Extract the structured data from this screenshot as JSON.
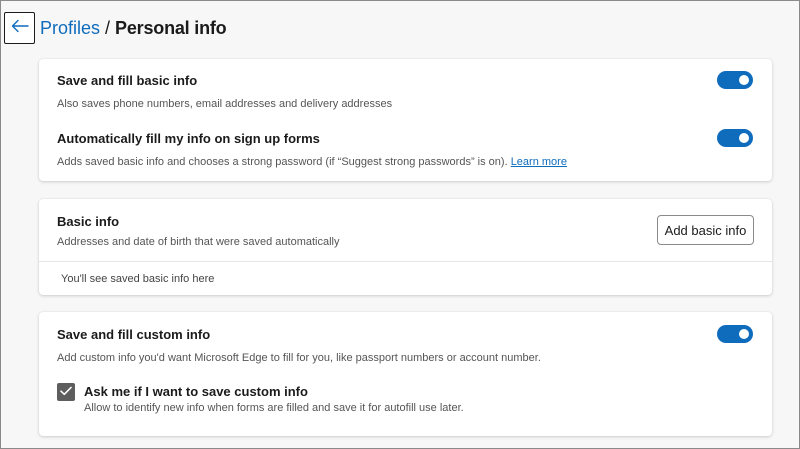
{
  "header": {
    "back_icon": "arrow-left-icon",
    "breadcrumb_parent": "Profiles",
    "breadcrumb_separator": "/",
    "breadcrumb_current": "Personal info"
  },
  "autofill_card": {
    "save_basic": {
      "title": "Save and fill basic info",
      "description": "Also saves phone numbers, email addresses and delivery addresses",
      "enabled": true
    },
    "auto_signup": {
      "title": "Automatically fill my info on sign up forms",
      "description": "Adds saved basic info and chooses a strong password (if “Suggest strong passwords” is on).",
      "link": "Learn more",
      "enabled": true
    }
  },
  "basic_info_card": {
    "title": "Basic info",
    "description": "Addresses and date of birth that were saved automatically",
    "add_button_label": "Add basic info",
    "empty_message": "You'll see saved basic info here"
  },
  "custom_info_card": {
    "title": "Save and fill custom info",
    "description": "Add custom info you'd want Microsoft Edge to fill for you, like passport numbers or account number.",
    "enabled": true,
    "ask_save": {
      "title": "Ask me if I want to save custom info",
      "description": "Allow to identify new info when forms are filled and save it for autofill use later.",
      "checked": true
    }
  },
  "colors": {
    "accent": "#0f6cbd",
    "background": "#f7f7f7",
    "checkbox": "#5e5e5e"
  }
}
